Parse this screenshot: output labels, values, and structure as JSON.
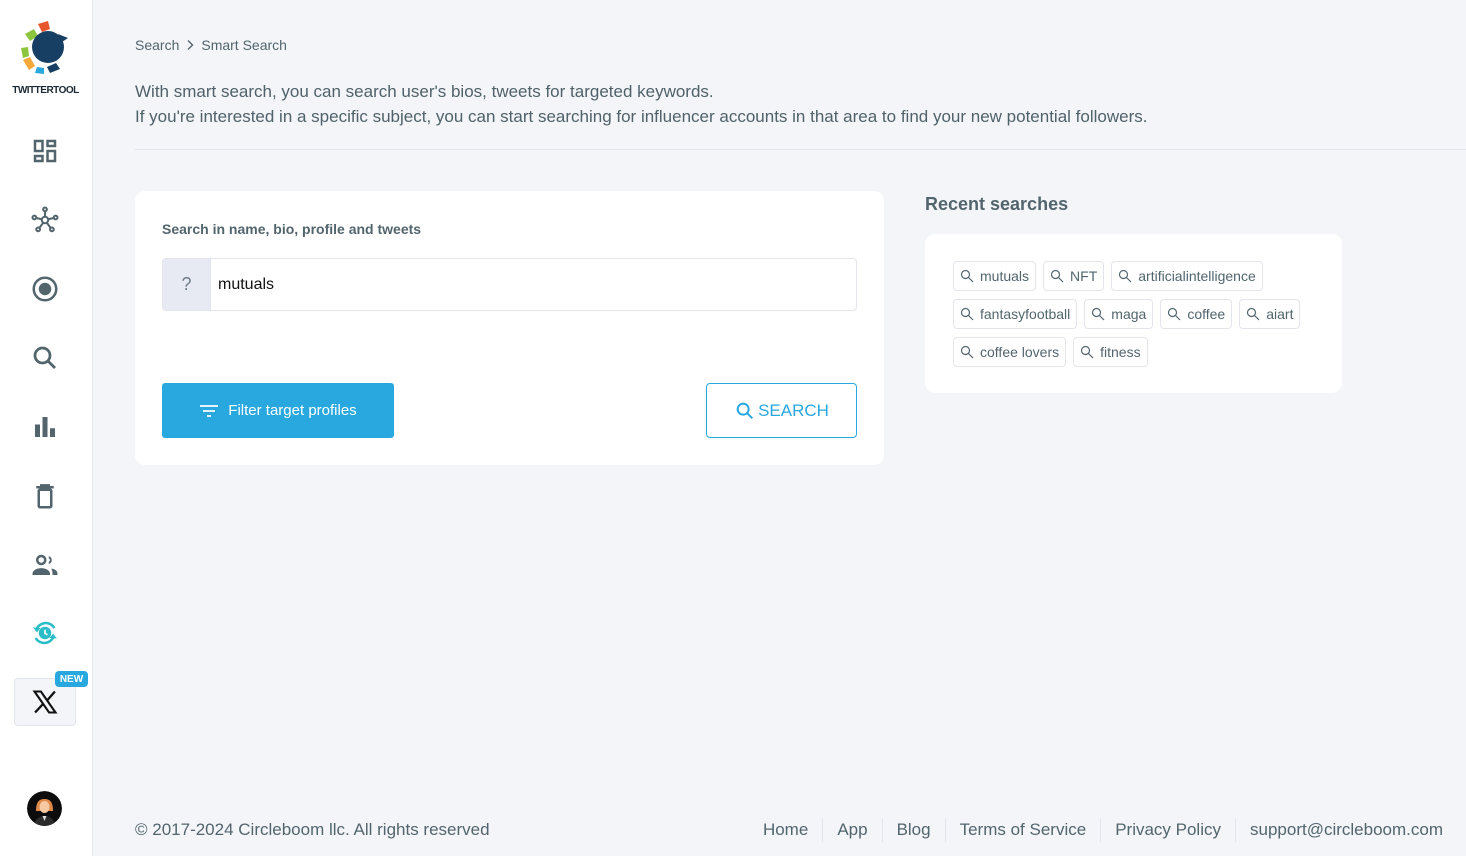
{
  "brand": {
    "name": "TWITTERTOOL"
  },
  "sidebar": {
    "items": [
      {
        "name": "dashboard",
        "icon": "dashboard-icon"
      },
      {
        "name": "network",
        "icon": "network-hub-icon"
      },
      {
        "name": "target",
        "icon": "radio-target-icon"
      },
      {
        "name": "search",
        "icon": "search-icon"
      },
      {
        "name": "analytics",
        "icon": "bar-chart-icon"
      },
      {
        "name": "delete",
        "icon": "trash-icon"
      },
      {
        "name": "users",
        "icon": "people-icon"
      },
      {
        "name": "scheduler",
        "icon": "clock-sync-icon",
        "color": "#2bbdc7"
      },
      {
        "name": "x",
        "icon": "x-logo-icon",
        "badge": "NEW"
      }
    ]
  },
  "breadcrumb": {
    "parent": "Search",
    "current": "Smart Search"
  },
  "intro": {
    "line1": "With smart search, you can search user's bios, tweets for targeted keywords.",
    "line2": "If you're interested in a specific subject, you can start searching for influencer accounts in that area to find your new potential followers."
  },
  "search_card": {
    "label": "Search in name, bio, profile and tweets",
    "addon": "?",
    "value": "mutuals",
    "filter_button": "Filter target profiles",
    "search_button": "SEARCH"
  },
  "recent": {
    "title": "Recent searches",
    "items": [
      "mutuals",
      "NFT",
      "artificialintelligence",
      "fantasyfootball",
      "maga",
      "coffee",
      "aiart",
      "coffee lovers",
      "fitness"
    ]
  },
  "footer": {
    "copyright": "© 2017-2024 Circleboom llc. All rights reserved",
    "links": [
      "Home",
      "App",
      "Blog",
      "Terms of Service",
      "Privacy Policy",
      "support@circleboom.com"
    ]
  },
  "colors": {
    "accent": "#29a8e0",
    "text": "#52656d",
    "background": "#f4f5f9",
    "teal": "#2bbdc7"
  }
}
